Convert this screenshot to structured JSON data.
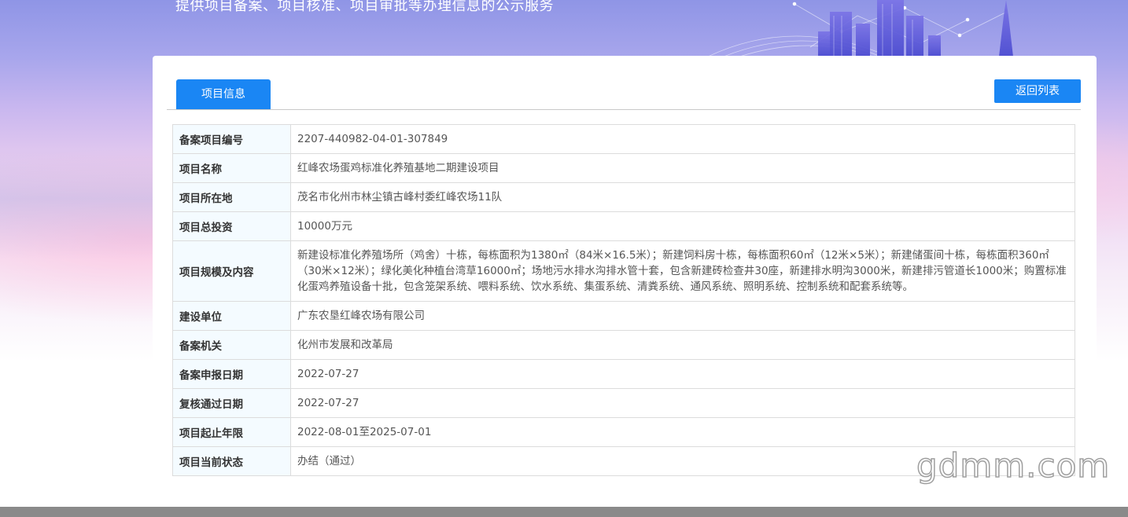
{
  "header": {
    "subtitle": "提供项目备案、项目核准、项目审批等办理信息的公示服务"
  },
  "tabs": [
    {
      "label": "项目信息",
      "active": true
    }
  ],
  "toolbar": {
    "back_label": "返回列表"
  },
  "project": {
    "rows": [
      {
        "label": "备案项目编号",
        "value": "2207-440982-04-01-307849"
      },
      {
        "label": "项目名称",
        "value": "红峰农场蛋鸡标准化养殖基地二期建设项目"
      },
      {
        "label": "项目所在地",
        "value": "茂名市化州市林尘镇古峰村委红峰农场11队"
      },
      {
        "label": "项目总投资",
        "value": "10000万元"
      },
      {
        "label": "项目规模及内容",
        "value": "新建设标准化养殖场所（鸡舍）十栋，每栋面积为1380㎡（84米×16.5米）；新建饲料房十栋，每栋面积60㎡（12米×5米）；新建储蛋间十栋，每栋面积360㎡（30米×12米）；绿化美化种植台湾草16000㎡；场地污水排水沟排水管十套，包含新建砖检查井30座，新建排水明沟3000米，新建排污管道长1000米；购置标准化蛋鸡养殖设备十批，包含笼架系统、喂料系统、饮水系统、集蛋系统、清粪系统、通风系统、照明系统、控制系统和配套系统等。"
      },
      {
        "label": "建设单位",
        "value": "广东农垦红峰农场有限公司"
      },
      {
        "label": "备案机关",
        "value": "化州市发展和改革局"
      },
      {
        "label": "备案申报日期",
        "value": "2022-07-27"
      },
      {
        "label": "复核通过日期",
        "value": "2022-07-27"
      },
      {
        "label": "项目起止年限",
        "value": "2022-08-01至2025-07-01"
      },
      {
        "label": "项目当前状态",
        "value": "办结（通过）"
      }
    ]
  },
  "watermark": {
    "text": "gdmm.com"
  },
  "colors": {
    "accent": "#1a86f4",
    "label_bg": "#f4fbff",
    "border": "#dcdcdc",
    "footer": "#8a8a8a"
  }
}
